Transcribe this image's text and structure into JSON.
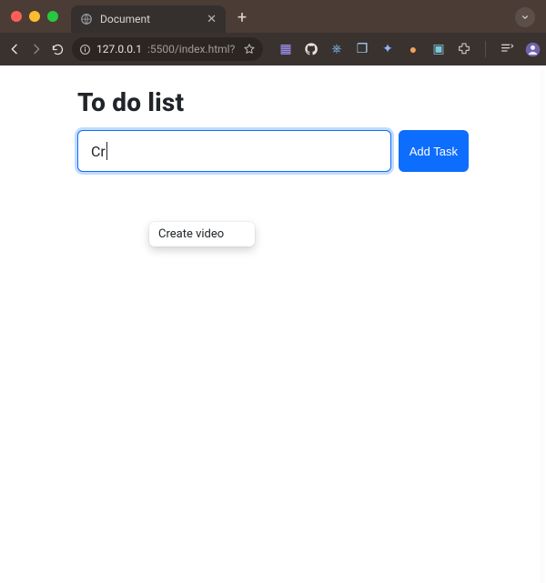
{
  "browser": {
    "tab_title": "Document",
    "url_host": "127.0.0.1",
    "url_port_path": ":5500/index.html?",
    "new_tab_label": "+"
  },
  "extensions": {
    "items": [
      {
        "name": "ext-1",
        "color": "#7b68ee",
        "glyph": "◧"
      },
      {
        "name": "github",
        "color": "#e8e3e0",
        "glyph": "◯"
      },
      {
        "name": "ext-3",
        "color": "#6fb7ff",
        "glyph": "⎈"
      },
      {
        "name": "ext-4",
        "color": "#9fd3ff",
        "glyph": "❐"
      },
      {
        "name": "ext-5",
        "color": "#7aa7ff",
        "glyph": "✦"
      },
      {
        "name": "ext-6",
        "color": "#f28c3b",
        "glyph": "●"
      },
      {
        "name": "ext-7",
        "color": "#6fc1d6",
        "glyph": "▣"
      },
      {
        "name": "extensions-menu",
        "color": "#d4cdc9",
        "glyph": "⧩"
      }
    ]
  },
  "page": {
    "heading": "To do list",
    "input_value": "Cr",
    "add_button_label": "Add Task",
    "autocomplete_suggestion": "Create video"
  },
  "colors": {
    "primary": "#0d6efd",
    "chrome_bg_top": "#4b3c36",
    "chrome_bg_toolbar": "#3a322f"
  }
}
